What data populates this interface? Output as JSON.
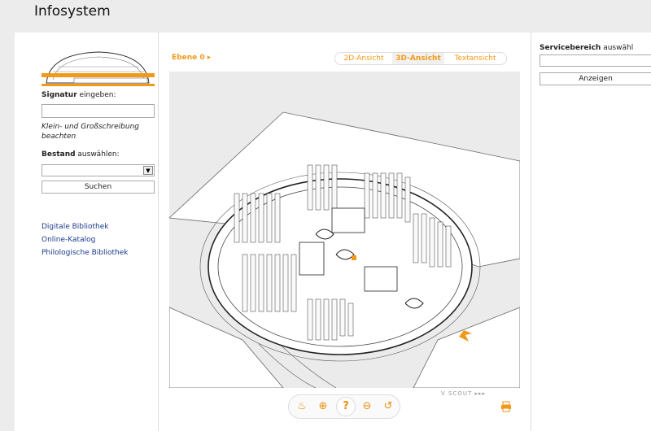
{
  "app": {
    "title": "Infosystem"
  },
  "left": {
    "signatur_label_bold": "Signatur",
    "signatur_label_rest": " eingeben:",
    "hint": "Klein- und Großschreibung beachten",
    "bestand_label_bold": "Bestand",
    "bestand_label_rest": " auswählen:",
    "search_button": "Suchen",
    "links": [
      "Digitale Bibliothek",
      "Online-Katalog",
      "Philologische Bibliothek"
    ]
  },
  "mid": {
    "level": "Ebene 0",
    "tabs": [
      "2D-Ansicht",
      "3D-Ansicht",
      "Textansicht"
    ],
    "active_tab": "3D-Ansicht",
    "scout_label": "V SCOUT",
    "accent_color": "#f29a18"
  },
  "right": {
    "service_bold": "Servicebereich",
    "service_rest": " auswähl",
    "show_button": "Anzeigen"
  },
  "icons": [
    "walk-icon",
    "zoom-in-icon",
    "help-pan-icon",
    "zoom-out-icon",
    "rotate-icon",
    "print-icon"
  ]
}
